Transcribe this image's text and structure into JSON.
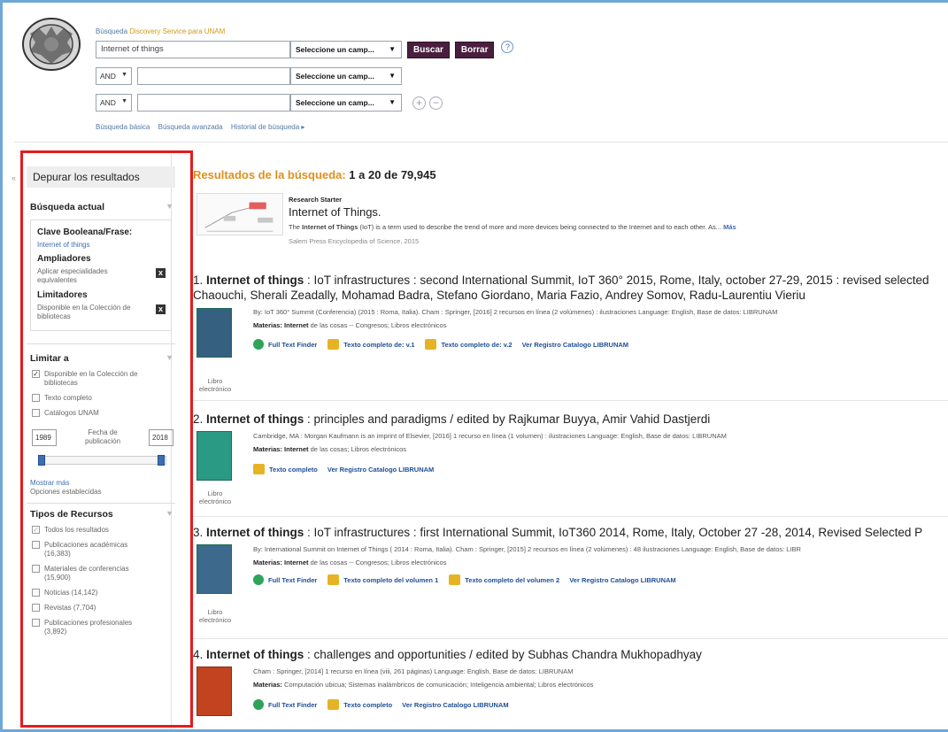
{
  "header": {
    "title_prefix": "Búsqueda",
    "title_brand": "Discovery Service para UNAM",
    "query": "Internet of things",
    "field_select": "Seleccione un camp...",
    "search_button": "Buscar",
    "clear_button": "Borrar",
    "help": "?",
    "op1": "AND",
    "op2": "AND",
    "plus": "+",
    "minus": "−",
    "links": [
      "Búsqueda básica",
      "Búsqueda avanzada",
      "Historial de búsqueda ▸"
    ]
  },
  "sidebar": {
    "header": "Depurar los resultados",
    "current_search_title": "Búsqueda actual",
    "boolean_label": "Clave Booleana/Frase:",
    "boolean_value": "Internet of things",
    "expanders_label": "Ampliadores",
    "expander_item": "Aplicar especialidades equivalentes",
    "limiters_label": "Limitadores",
    "limiter_item": "Disponible en la Colección de bibliotecas",
    "remove": "x",
    "limit_title": "Limitar a",
    "limit_options": [
      {
        "label": "Disponible en la Colección de bibliotecas",
        "checked": true
      },
      {
        "label": "Texto completo",
        "checked": false
      },
      {
        "label": "Catálogos UNAM",
        "checked": false
      }
    ],
    "date_from": "1989",
    "date_label": "Fecha de publicación",
    "date_to": "2018",
    "date_range_fraction": [
      0.0,
      1.0
    ],
    "show_more": "Mostrar más",
    "options_set": "Opciones establecidas",
    "types_title": "Tipos de Recursos",
    "types": [
      {
        "label": "Todos los resultados",
        "checked": true
      },
      {
        "label": "Publicaciones académicas (16,383)",
        "checked": false
      },
      {
        "label": "Materiales de conferencias (15,900)",
        "checked": false
      },
      {
        "label": "Noticias (14,142)",
        "checked": false
      },
      {
        "label": "Revistas (7,704)",
        "checked": false
      },
      {
        "label": "Publicaciones profesionales (3,892)",
        "checked": false
      }
    ]
  },
  "results": {
    "heading_label": "Resultados de la búsqueda:",
    "heading_range": "1 a 20 de 79,945",
    "research_starter": {
      "kind": "Research Starter",
      "title": "Internet of Things.",
      "desc_bold": "Internet of Things",
      "desc_pre": "The",
      "desc_post": "(IoT) is a term used to describe the trend of more and more devices being connected to the Internet and to each other. As...",
      "more": "Más",
      "source": "Salem Press Encyclopedia of Science, 2015"
    },
    "records": [
      {
        "num": "1.",
        "title_bold": "Internet of things",
        "title_rest": ": IoT infrastructures : second International Summit, IoT 360° 2015, Rome, Italy, october 27-29, 2015 : revised selected",
        "title_line2": "Chaouchi, Sherali Zeadally, Mohamad Badra, Stefano Giordano, Maria Fazio, Andrey Somov, Radu-Laurentiu Vieriu",
        "meta": "By: IoT 360° Summit (Conferencia) (2015 : Roma, Italia). Cham : Springer, [2016] 2 recursos en línea (2 volúmenes) : ilustraciones Language: English, Base de datos: LIBRUNAM",
        "subj_label": "Materias:",
        "subj_bold": "Internet",
        "subj_rest": "de las cosas -- Congresos; Libros electrónicos",
        "links": [
          "Full Text Finder",
          "Texto completo de: v.1",
          "Texto completo de: v.2",
          "Ver Registro Catalogo LIBRUNAM"
        ],
        "type": "Libro electrónico"
      },
      {
        "num": "2.",
        "title_bold": "Internet of things",
        "title_rest": ": principles and paradigms / edited by Rajkumar Buyya, Amir Vahid Dastjerdi",
        "meta": "Cambridge, MA : Morgan Kaufmann is an imprint of Elsevier, [2016] 1 recurso en línea (1 volumen) : ilustraciones Language: English, Base de datos: LIBRUNAM",
        "subj_label": "Materias:",
        "subj_bold": "Internet",
        "subj_rest": "de las cosas; Libros electrónicos",
        "links": [
          "Texto completo",
          "Ver Registro Catalogo LIBRUNAM"
        ],
        "type": "Libro electrónico"
      },
      {
        "num": "3.",
        "title_bold": "Internet of things",
        "title_rest": ": IoT infrastructures : first International Summit, IoT360 2014, Rome, Italy, October 27 -28, 2014, Revised Selected P",
        "meta": "By: International Summit on Internet of Things ( 2014 : Roma, Italia). Cham : Springer, [2015] 2 recursos en línea (2 volúmenes) : 48 ilustraciones Language: English, Base de datos: LIBR",
        "subj_label": "Materias:",
        "subj_bold": "Internet",
        "subj_rest": "de las cosas -- Congresos; Libros electrónicos",
        "links": [
          "Full Text Finder",
          "Texto completo del volumen 1",
          "Texto completo del volumen 2",
          "Ver Registro Catalogo LIBRUNAM"
        ],
        "type": "Libro electrónico"
      },
      {
        "num": "4.",
        "title_bold": "Internet of things",
        "title_rest": ": challenges and opportunities / edited by Subhas Chandra Mukhopadhyay",
        "meta": "Cham : Springer, [2014] 1 recurso en línea (viii, 261 páginas) Language: English, Base de datos: LIBRUNAM",
        "subj_label": "Materias:",
        "subj_rest": "Computación ubicua; Sistemas inalámbricos de comunicación; Inteligencia ambiental; Libros electrónicos",
        "links": [
          "Full Text Finder",
          "Texto completo",
          "Ver Registro Catalogo LIBRUNAM"
        ]
      }
    ]
  },
  "colors": {
    "highlight_border": "#e41c1c",
    "button": "#4a1f3e",
    "accent_orange": "#e08f1b",
    "link": "#3c6eb4"
  }
}
